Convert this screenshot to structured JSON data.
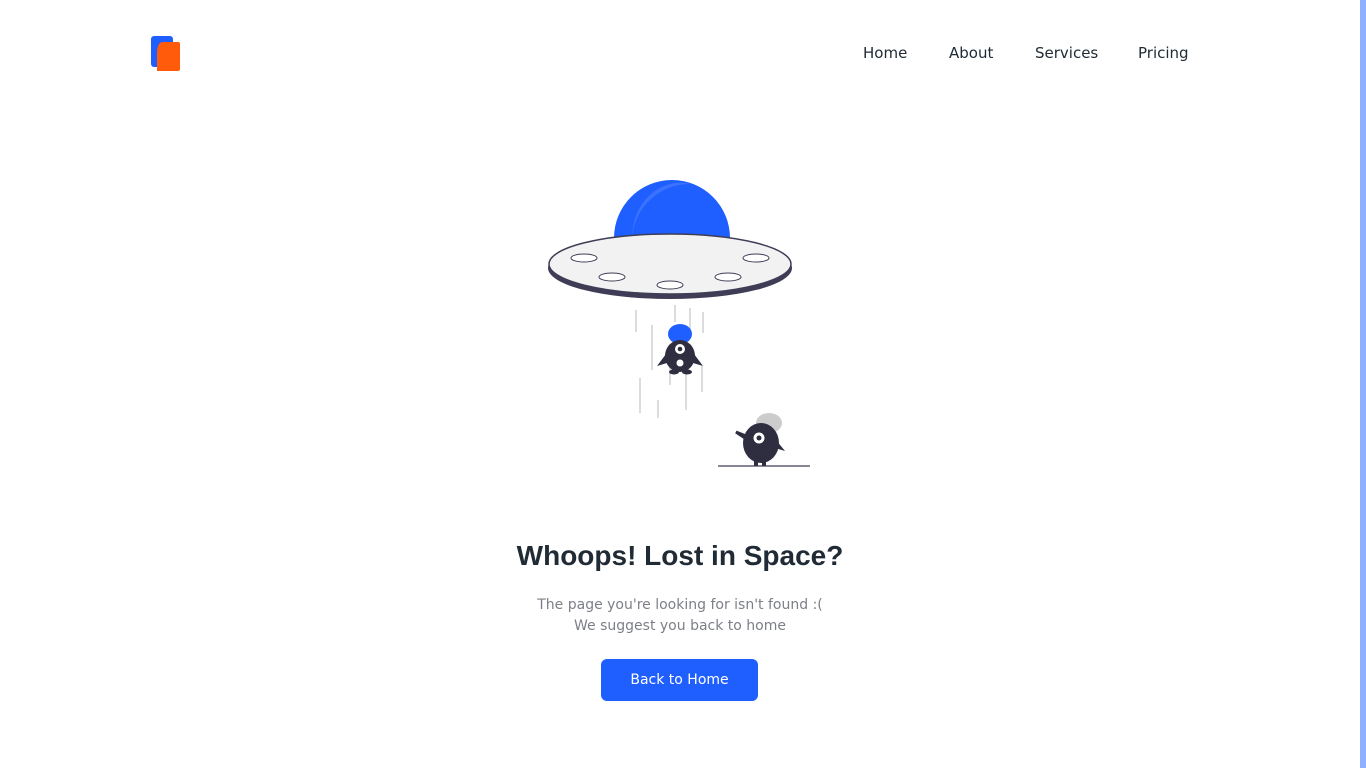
{
  "nav": {
    "links": [
      "Home",
      "About",
      "Services",
      "Pricing"
    ]
  },
  "hero": {
    "title": "Whoops! Lost in Space?",
    "line1": "The page you're looking for isn't found :(",
    "line2": "We suggest you back to home",
    "button_label": "Back to Home"
  },
  "colors": {
    "primary": "#1f5eff",
    "accent_orange": "#ff5b0a",
    "heading": "#212b36",
    "muted_text": "#7d7f88",
    "ufo_body": "#f2f2f2",
    "ufo_rim": "#3f3d56",
    "alien": "#2f2e41"
  },
  "icons": {
    "logo": "brand-logo-icon",
    "illustration": "ufo-abduction-illustration"
  }
}
